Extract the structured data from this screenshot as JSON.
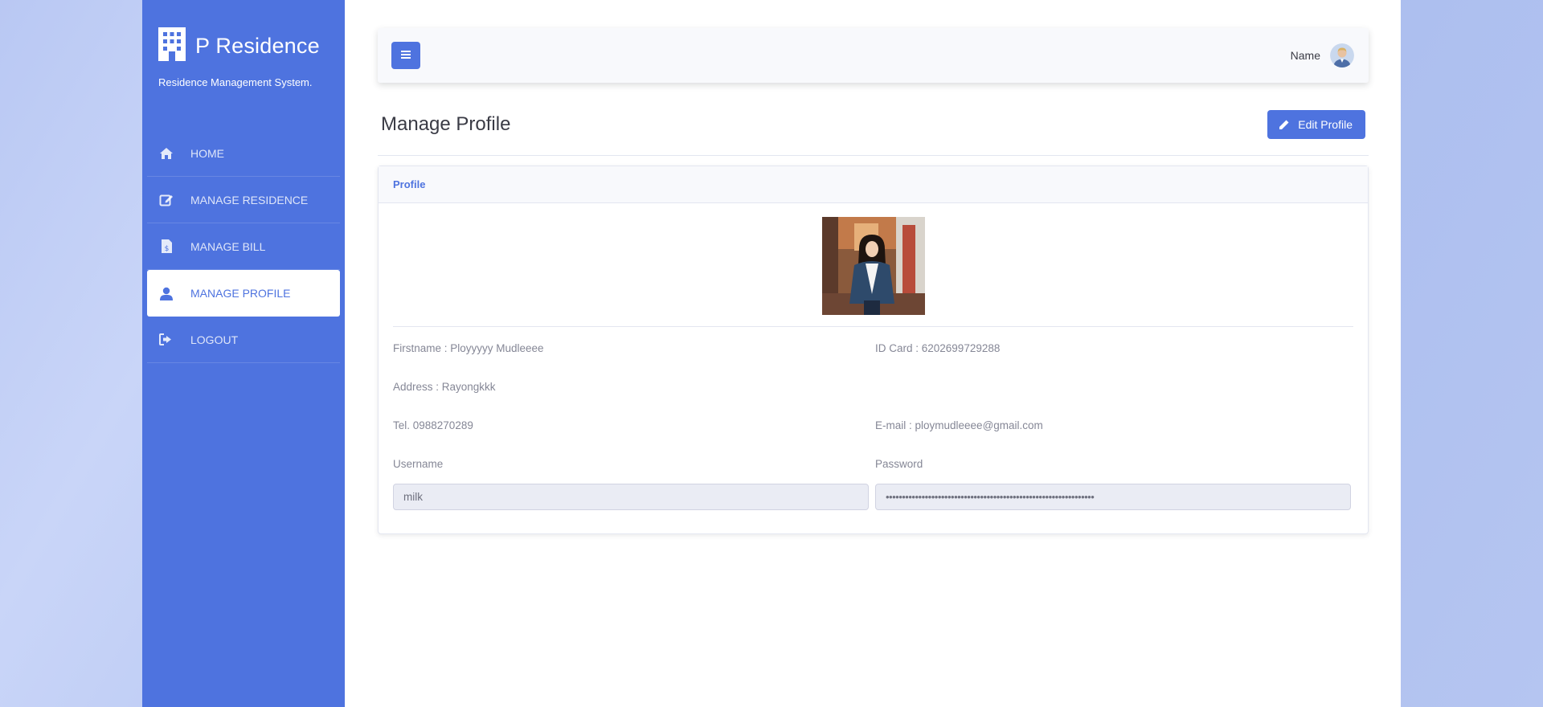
{
  "brand": {
    "title": "P Residence",
    "subtitle": "Residence Management System."
  },
  "nav": {
    "items": [
      {
        "label": "HOME",
        "icon": "home-icon"
      },
      {
        "label": "MANAGE RESIDENCE",
        "icon": "edit-icon"
      },
      {
        "label": "MANAGE BILL",
        "icon": "invoice-icon"
      },
      {
        "label": "MANAGE PROFILE",
        "icon": "user-icon",
        "active": true
      },
      {
        "label": "LOGOUT",
        "icon": "sign-out-icon"
      }
    ]
  },
  "topbar": {
    "user_name": "Name",
    "menu_icon": "hamburger-icon"
  },
  "page": {
    "title": "Manage Profile",
    "edit_button": "Edit Profile"
  },
  "card": {
    "header": "Profile"
  },
  "profile": {
    "firstname": "Firstname : Ployyyyy   Mudleeee",
    "id_card": "ID Card : 6202699729288",
    "address": "Address : Rayongkkk",
    "tel": "Tel. 0988270289",
    "email": "E-mail : ploymudleeee@gmail.com",
    "username_label": "Username",
    "password_label": "Password",
    "username_value": "milk",
    "password_value": "••••••••••••••••••••••••••••••••••••••••••••••••••••••••••••••••"
  },
  "colors": {
    "primary": "#4e73df",
    "background": "#b9c8f3"
  }
}
